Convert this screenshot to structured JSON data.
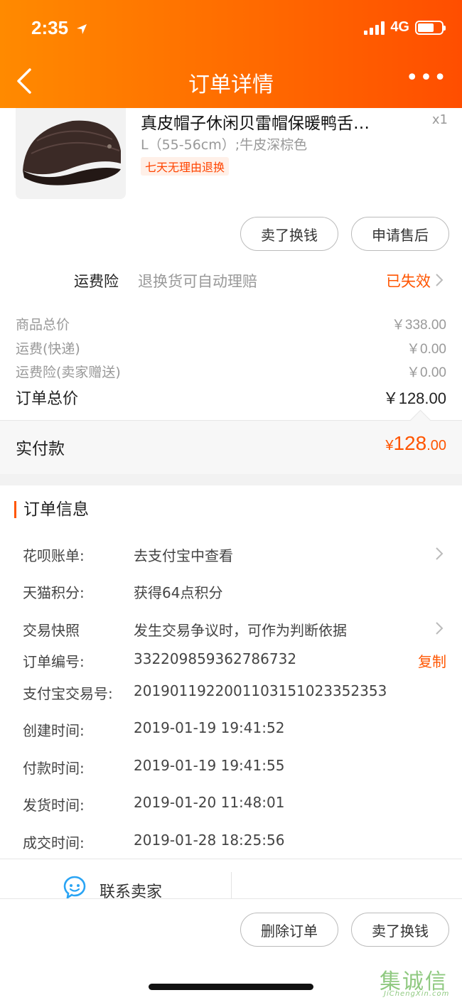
{
  "status_bar": {
    "time": "2:35",
    "network": "4G"
  },
  "header": {
    "title": "订单详情",
    "more": "•••"
  },
  "product": {
    "name": "真皮帽子休闲贝雷帽保暖鸭舌…",
    "spec": "L（55-56cm）;牛皮深棕色",
    "tag": "七天无理由退换",
    "qty": "x1"
  },
  "product_actions": {
    "sell": "卖了换钱",
    "aftersale": "申请售后"
  },
  "insurance": {
    "label": "运费险",
    "desc": "退换货可自动理赔",
    "status": "已失效"
  },
  "prices": [
    {
      "label": "商品总价",
      "value": "￥338.00"
    },
    {
      "label": "运费(快递)",
      "value": "￥0.00"
    },
    {
      "label": "运费险(卖家赠送)",
      "value": "￥0.00"
    }
  ],
  "order_total": {
    "label": "订单总价",
    "value": "￥128.00"
  },
  "paid": {
    "label": "实付款",
    "symbol": "¥",
    "int": "128",
    "dec": ".00"
  },
  "order_info": {
    "title": "订单信息",
    "rows": [
      {
        "key": "花呗账单:",
        "value": "去支付宝中查看"
      },
      {
        "key": "天猫积分:",
        "value": "获得64点积分"
      },
      {
        "key": "交易快照",
        "value": "发生交易争议时，可作为判断依据"
      },
      {
        "key": "订单编号:",
        "value": "332209859362786732",
        "action": "复制"
      },
      {
        "key": "支付宝交易号:",
        "value": "2019011922001103151023352353"
      },
      {
        "key": "创建时间:",
        "value": "2019-01-19 19:41:52"
      },
      {
        "key": "付款时间:",
        "value": "2019-01-19 19:41:55"
      },
      {
        "key": "发货时间:",
        "value": "2019-01-20 11:48:01"
      },
      {
        "key": "成交时间:",
        "value": "2019-01-28 18:25:56"
      }
    ]
  },
  "contact": {
    "label": "联系卖家"
  },
  "bottom_actions": {
    "delete": "删除订单",
    "sell": "卖了换钱"
  },
  "watermark": {
    "chars": "集诚信",
    "url": "JiChengXin.com"
  },
  "colors": {
    "accent": "#ff5500",
    "header_start": "#ff8a00",
    "header_end": "#ff4e00"
  }
}
